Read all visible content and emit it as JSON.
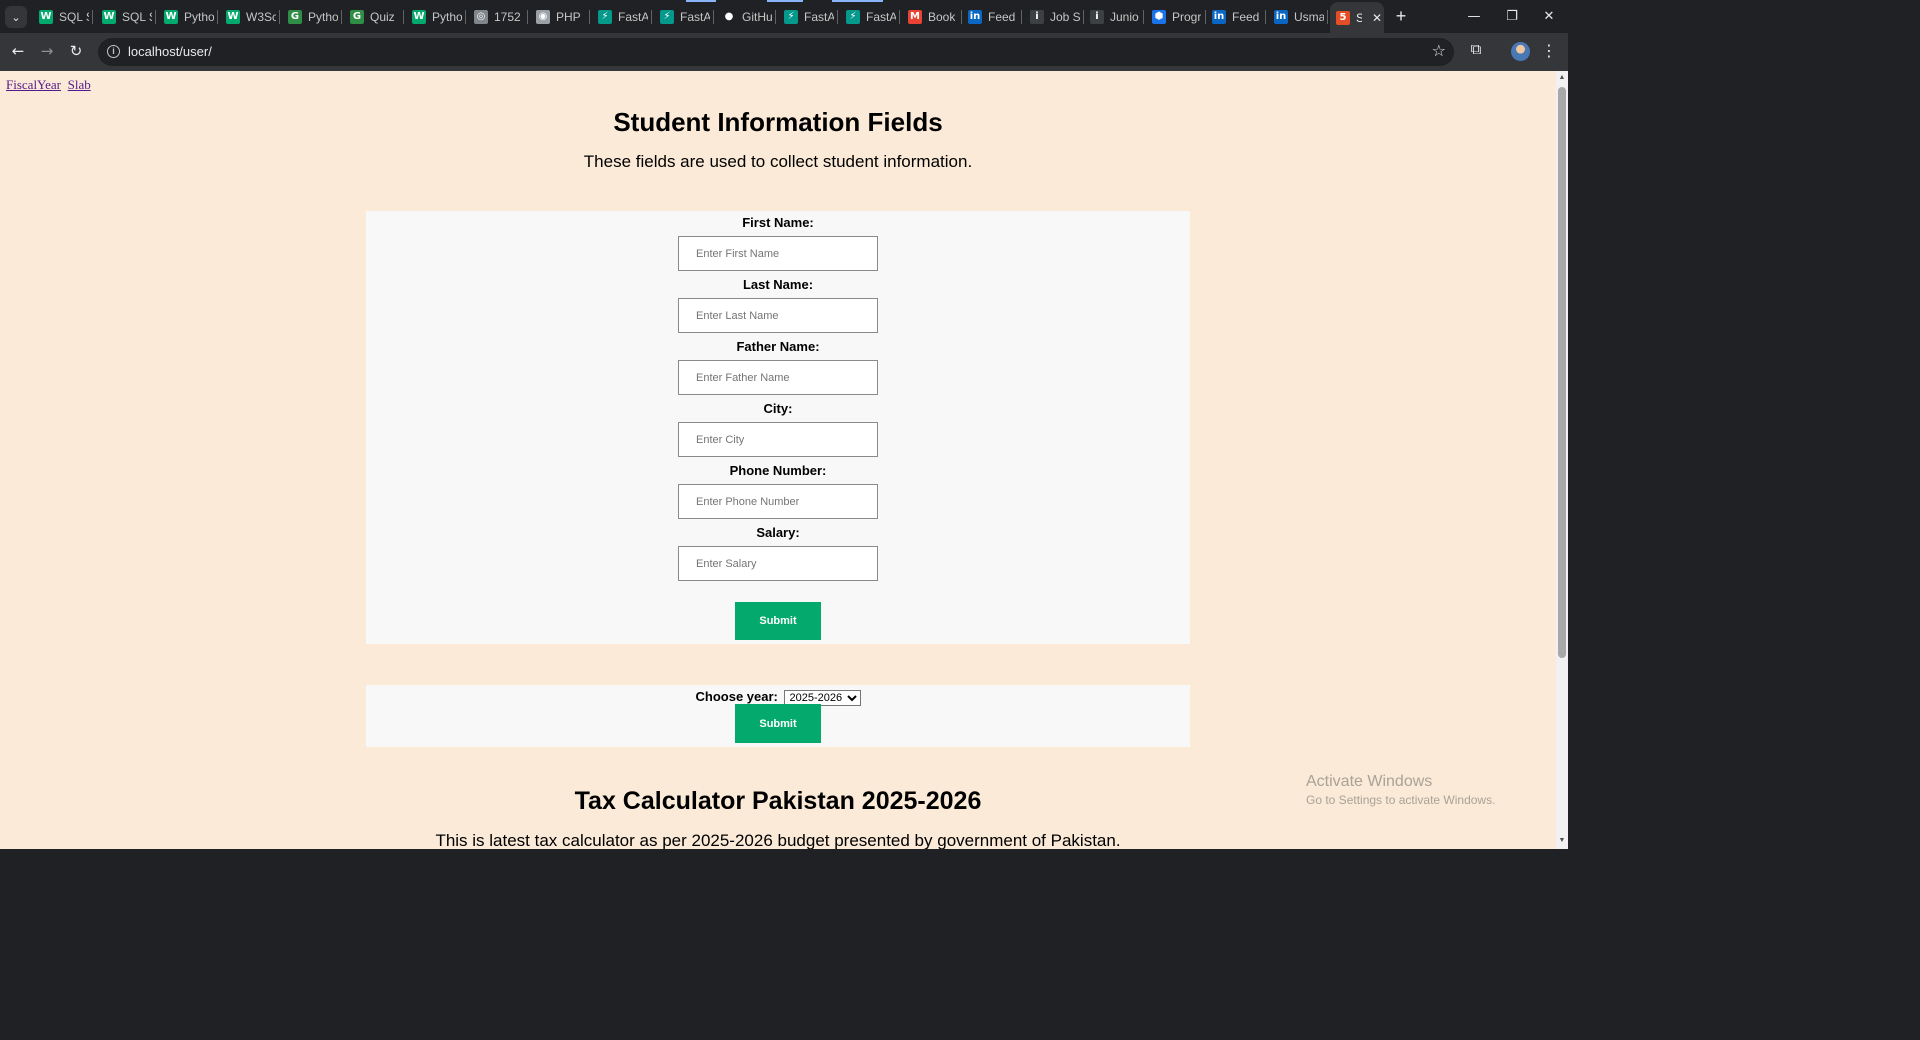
{
  "browser": {
    "tabs": [
      {
        "title": "SQL S",
        "icon": "w3schools-icon",
        "color": "#04aa6d",
        "glyph": "W"
      },
      {
        "title": "SQL S",
        "icon": "w3schools-icon",
        "color": "#04aa6d",
        "glyph": "W"
      },
      {
        "title": "Pytho",
        "icon": "w3schools-icon",
        "color": "#04aa6d",
        "glyph": "W"
      },
      {
        "title": "W3Sc",
        "icon": "w3schools-icon",
        "color": "#04aa6d",
        "glyph": "W"
      },
      {
        "title": "Pytho",
        "icon": "geeksforgeeks-icon",
        "color": "#2f8d46",
        "glyph": "G"
      },
      {
        "title": "Quiz",
        "icon": "geeksforgeeks-icon",
        "color": "#2f8d46",
        "glyph": "G"
      },
      {
        "title": "Pytho",
        "icon": "w3schools-icon",
        "color": "#04aa6d",
        "glyph": "W"
      },
      {
        "title": "1752",
        "icon": "globe-icon",
        "color": "#80868b",
        "glyph": "◎"
      },
      {
        "title": "PHP",
        "icon": "target-icon",
        "color": "#9aa0a6",
        "glyph": "◉"
      },
      {
        "title": "FastA",
        "icon": "fastapi-icon",
        "color": "#05998b",
        "glyph": "⚡"
      },
      {
        "title": "FastA",
        "icon": "fastapi-icon",
        "color": "#05998b",
        "glyph": "⚡"
      },
      {
        "title": "GitHu",
        "icon": "github-icon",
        "color": "#202124",
        "glyph": "●"
      },
      {
        "title": "FastA",
        "icon": "fastapi-icon",
        "color": "#05998b",
        "glyph": "⚡"
      },
      {
        "title": "FastA",
        "icon": "fastapi-icon",
        "color": "#05998b",
        "glyph": "⚡"
      },
      {
        "title": "Book",
        "icon": "gmail-icon",
        "color": "#ea4335",
        "glyph": "M"
      },
      {
        "title": "Feed",
        "icon": "linkedin-icon",
        "color": "#0a66c2",
        "glyph": "in"
      },
      {
        "title": "Job S",
        "icon": "info-icon",
        "color": "#3c4043",
        "glyph": "i"
      },
      {
        "title": "Junio",
        "icon": "info-icon",
        "color": "#3c4043",
        "glyph": "i"
      },
      {
        "title": "Progr",
        "icon": "hexagon-icon",
        "color": "#1a73e8",
        "glyph": "⬢"
      },
      {
        "title": "Feed",
        "icon": "linkedin-icon",
        "color": "#0a66c2",
        "glyph": "in"
      },
      {
        "title": "Usma",
        "icon": "linkedin-icon",
        "color": "#0a66c2",
        "glyph": "in"
      },
      {
        "title": "S",
        "icon": "html5-icon",
        "color": "#e44d26",
        "glyph": "5",
        "active": true
      }
    ],
    "new_tab_glyph": "+",
    "window_minimize": "—",
    "window_restore": "❐",
    "window_close": "✕",
    "url": "localhost/user/"
  },
  "page": {
    "links": [
      "FiscalYear",
      "Slab"
    ],
    "title": "Student Information Fields",
    "subtitle": "These fields are used to collect student information.",
    "form": {
      "fields": [
        {
          "label": "First Name:",
          "placeholder": "Enter First Name"
        },
        {
          "label": "Last Name:",
          "placeholder": "Enter Last Name"
        },
        {
          "label": "Father Name:",
          "placeholder": "Enter Father Name"
        },
        {
          "label": "City:",
          "placeholder": "Enter City"
        },
        {
          "label": "Phone Number:",
          "placeholder": "Enter Phone Number"
        },
        {
          "label": "Salary:",
          "placeholder": "Enter Salary"
        }
      ],
      "submit_label": "Submit"
    },
    "year_form": {
      "label": "Choose year:",
      "selected": "2025-2026",
      "submit_label": "Submit"
    },
    "tax_title": "Tax Calculator Pakistan 2025-2026",
    "tax_subtitle": "This is latest tax calculator as per 2025-2026 budget presented by government of Pakistan."
  },
  "watermark": {
    "line1": "Activate Windows",
    "line2": "Go to Settings to activate Windows."
  }
}
